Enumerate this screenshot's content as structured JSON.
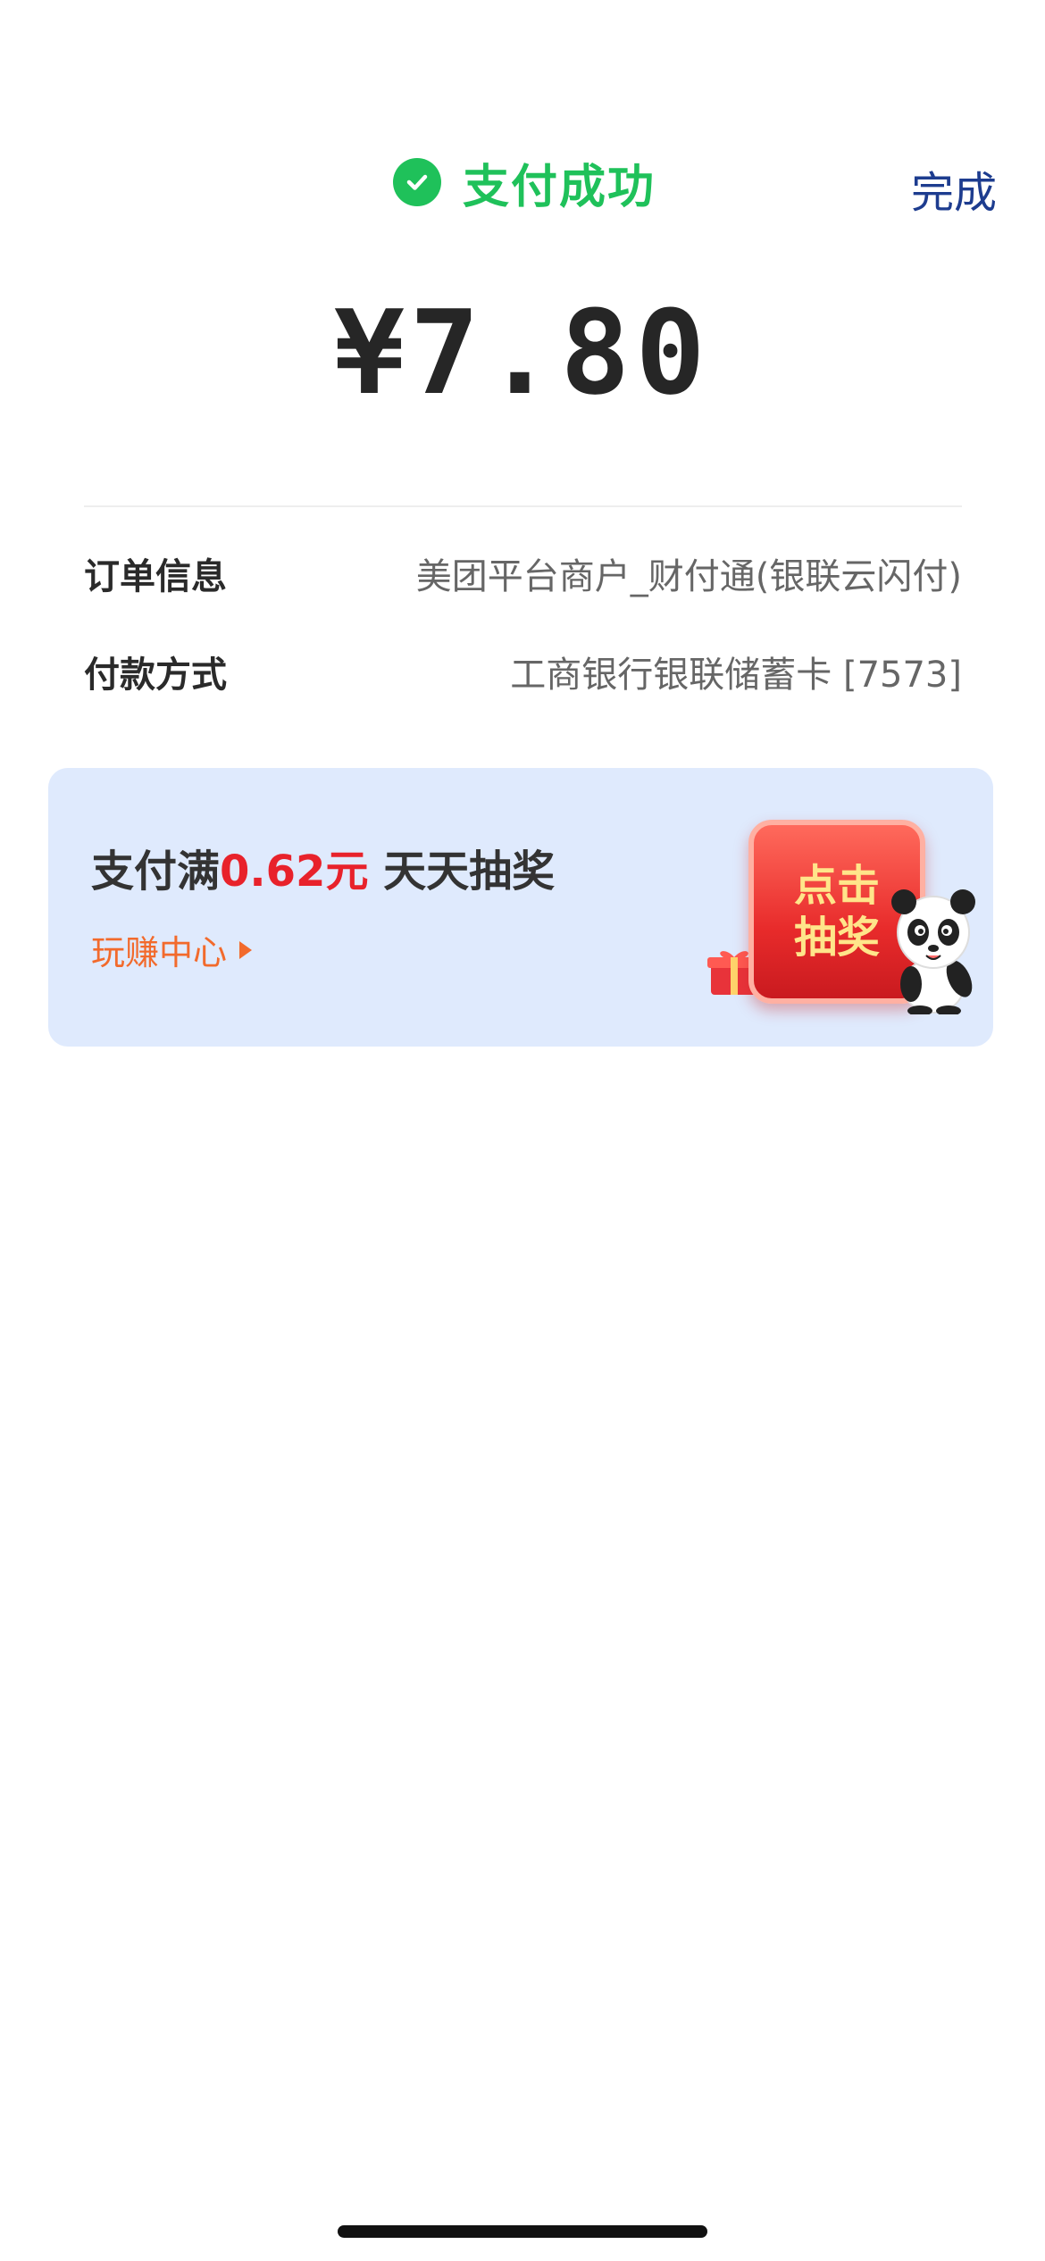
{
  "header": {
    "status_text": "支付成功",
    "done_label": "完成",
    "status_color": "#1fc15a"
  },
  "payment": {
    "amount": "¥7.80"
  },
  "details": {
    "order_label": "订单信息",
    "order_value": "美团平台商户_财付通(银联云闪付)",
    "method_label": "付款方式",
    "method_value": "工商银行银联储蓄卡 [7573]"
  },
  "promo": {
    "title_prefix": "支付满",
    "title_amount": "0.62元",
    "title_suffix": " 天天抽奖",
    "link_label": "玩赚中心",
    "button_line1": "点击",
    "button_line2": "抽奖",
    "highlight_color": "#e8222b",
    "link_color": "#f26a2c"
  }
}
